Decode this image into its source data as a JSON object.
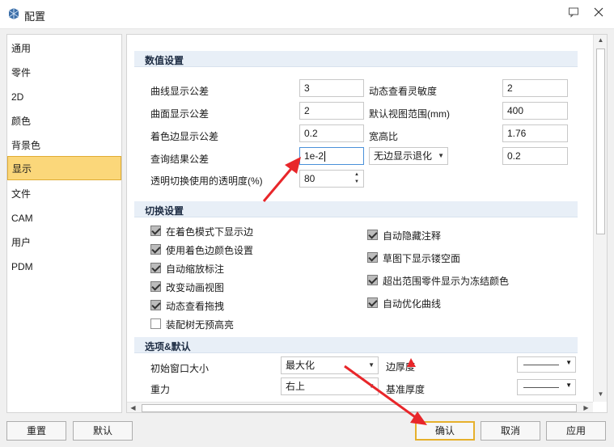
{
  "window": {
    "title": "配置",
    "pin_icon": "comment-icon",
    "close_icon": "close-icon"
  },
  "sidebar": {
    "items": [
      {
        "label": "通用"
      },
      {
        "label": "零件"
      },
      {
        "label": "2D"
      },
      {
        "label": "颜色"
      },
      {
        "label": "背景色"
      },
      {
        "label": "显示",
        "selected": true
      },
      {
        "label": "文件"
      },
      {
        "label": "CAM"
      },
      {
        "label": "用户"
      },
      {
        "label": "PDM"
      }
    ]
  },
  "numeric": {
    "title": "数值设置",
    "curve_tol_label": "曲线显示公差",
    "curve_tol": "3",
    "dyn_sens_label": "动态查看灵敏度",
    "dyn_sens": "2",
    "surface_tol_label": "曲面显示公差",
    "surface_tol": "2",
    "view_range_label": "默认视图范围(mm)",
    "view_range": "400",
    "edge_tol_label": "着色边显示公差",
    "edge_tol": "0.2",
    "aspect_label": "宽高比",
    "aspect": "1.76",
    "query_tol_label": "查询结果公差",
    "query_tol": "1e-2",
    "fallback_combo": "无边显示退化",
    "fallback_value": "0.2",
    "transparency_label": "透明切换使用的透明度(%)",
    "transparency": "80"
  },
  "switch": {
    "title": "切换设置",
    "left": [
      {
        "label": "在着色模式下显示边",
        "checked": true
      },
      {
        "label": "使用着色边颜色设置",
        "checked": true
      },
      {
        "label": "自动缩放标注",
        "checked": true
      },
      {
        "label": "改变动画视图",
        "checked": true
      },
      {
        "label": "动态查看拖拽",
        "checked": true
      },
      {
        "label": "装配树无预高亮",
        "checked": false
      }
    ],
    "right": [
      {
        "label": "自动隐藏注释",
        "checked": true
      },
      {
        "label": "草图下显示镂空面",
        "checked": true
      },
      {
        "label": "超出范围零件显示为冻结颜色",
        "checked": true
      },
      {
        "label": "自动优化曲线",
        "checked": true
      }
    ]
  },
  "options": {
    "title": "选项&默认",
    "window_size_label": "初始窗口大小",
    "window_size": "最大化",
    "gravity_label": "重力",
    "gravity": "右上",
    "edge_thickness_label": "边厚度",
    "base_thickness_label": "基准厚度"
  },
  "buttons": {
    "reset": "重置",
    "default": "默认",
    "ok": "确认",
    "cancel": "取消",
    "apply": "应用"
  },
  "annotation_color": "#e8262a",
  "accent_color": "#fbd77a"
}
